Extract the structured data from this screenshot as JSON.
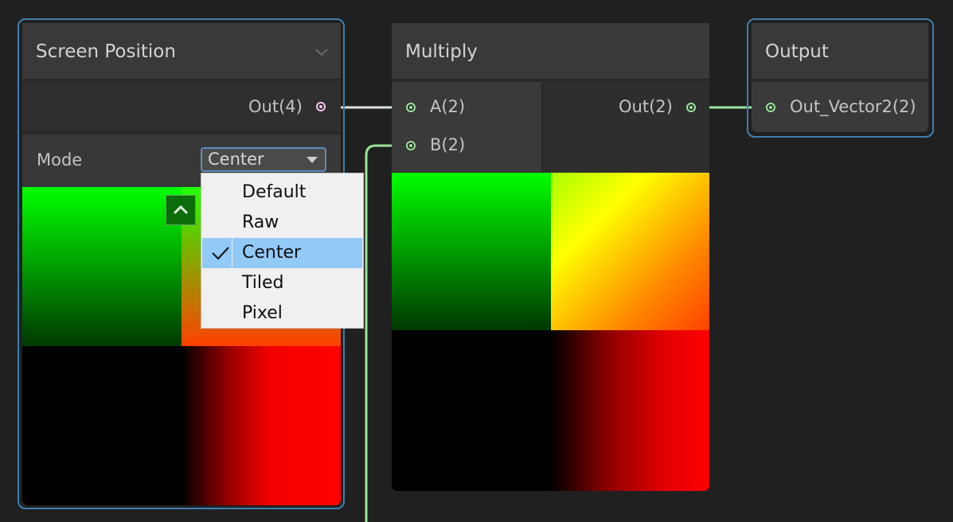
{
  "screen_position_node": {
    "title": "Screen Position",
    "collapse_icon": "chevron-down-icon",
    "output_port": {
      "label": "Out(4)",
      "color": "#f2c7ee"
    },
    "mode": {
      "label": "Mode",
      "selected_value": "Center"
    },
    "preview_collapse_icon": "chevron-up-icon"
  },
  "mode_dropdown": {
    "options": [
      {
        "label": "Default",
        "selected": false
      },
      {
        "label": "Raw",
        "selected": false
      },
      {
        "label": "Center",
        "selected": true
      },
      {
        "label": "Tiled",
        "selected": false
      },
      {
        "label": "Pixel",
        "selected": false
      }
    ],
    "check_icon": "checkmark-icon",
    "highlight_color": "#91c9f7"
  },
  "multiply_node": {
    "title": "Multiply",
    "inputs": [
      {
        "label": "A(2)",
        "color": "#9ae39a"
      },
      {
        "label": "B(2)",
        "color": "#9ae39a"
      }
    ],
    "output_port": {
      "label": "Out(2)",
      "color": "#9ae39a"
    }
  },
  "output_node": {
    "title": "Output",
    "input_port": {
      "label": "Out_Vector2(2)",
      "color": "#9ae39a"
    }
  },
  "colors": {
    "background": "#202020",
    "node_body": "#2b2b2b",
    "node_header": "#393939",
    "selection_outline": "#3d7fb1",
    "vector2_edge": "#9ae39a",
    "vector4_edge": "#f2c7ee"
  }
}
